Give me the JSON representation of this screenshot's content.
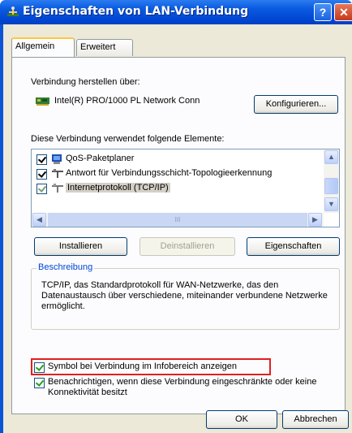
{
  "window": {
    "title": "Eigenschaften von LAN-Verbindung",
    "help_label": "?",
    "close_label": "✕"
  },
  "tabs": [
    {
      "label": "Allgemein",
      "active": true
    },
    {
      "label": "Erweitert",
      "active": false
    }
  ],
  "general": {
    "connect_via_label": "Verbindung herstellen über:",
    "device_name": "Intel(R) PRO/1000 PL Network Conn",
    "configure_button": "Konfigurieren...",
    "components_label": "Diese Verbindung verwendet folgende Elemente:",
    "components": [
      {
        "label": "QoS-Paketplaner",
        "checked": true,
        "icon": "qos-scheduler-icon",
        "selected": false
      },
      {
        "label": "Antwort für Verbindungsschicht-Topologieerkennung",
        "checked": true,
        "icon": "network-protocol-icon",
        "selected": false
      },
      {
        "label": "Internetprotokoll (TCP/IP)",
        "checked": true,
        "icon": "network-protocol-icon",
        "selected": true
      }
    ],
    "hscroll_grip": "III",
    "install_button": "Installieren",
    "uninstall_button": "Deinstallieren",
    "properties_button": "Eigenschaften",
    "description": {
      "title": "Beschreibung",
      "text": "TCP/IP, das Standardprotokoll für WAN-Netzwerke, das den Datenaustausch über verschiedene, miteinander verbundene Netzwerke ermöglicht."
    },
    "show_icon_label": "Symbol bei Verbindung im Infobereich anzeigen",
    "show_icon_checked": true,
    "notify_label": "Benachrichtigen, wenn diese Verbindung eingeschränkte oder keine Konnektivität besitzt",
    "notify_checked": true
  },
  "footer": {
    "ok_button": "OK",
    "cancel_button": "Abbrechen"
  },
  "colors": {
    "titlebar": "#0046d2",
    "dialog_bg": "#ece9d8",
    "highlight_border": "#e02020",
    "group_title": "#0046d5"
  }
}
